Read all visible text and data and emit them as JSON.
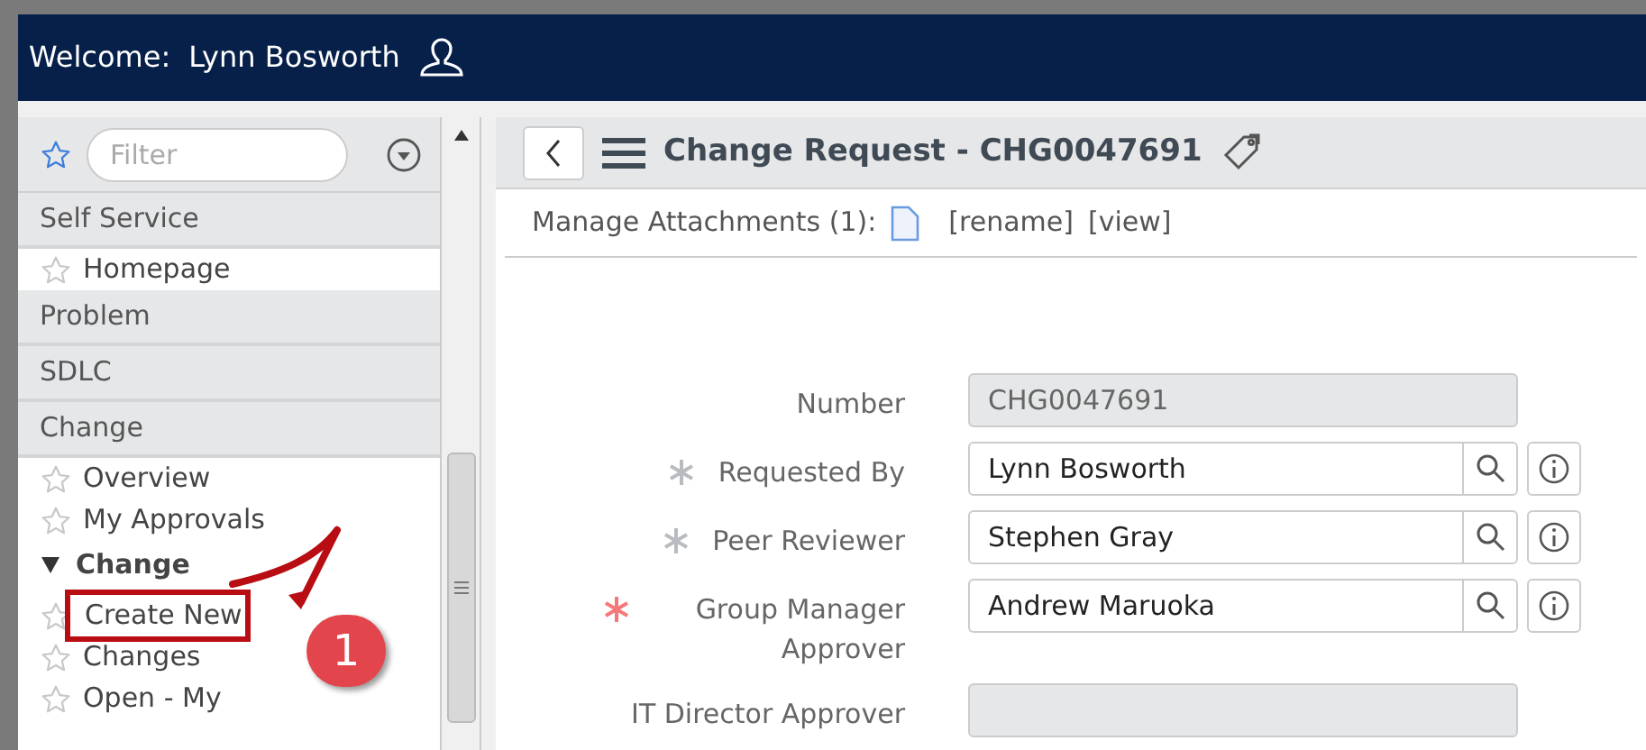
{
  "header": {
    "welcome": "Welcome:",
    "user": "Lynn Bosworth"
  },
  "sidebar": {
    "filter": {
      "placeholder": "Filter"
    },
    "items": [
      {
        "kind": "section",
        "label": "Self Service"
      },
      {
        "kind": "item",
        "label": "Homepage"
      },
      {
        "kind": "section",
        "label": "Problem"
      },
      {
        "kind": "section",
        "label": "SDLC"
      },
      {
        "kind": "section",
        "label": "Change"
      },
      {
        "kind": "item",
        "label": "Overview"
      },
      {
        "kind": "item",
        "label": "My Approvals"
      },
      {
        "kind": "group",
        "label": "Change",
        "expanded": true
      },
      {
        "kind": "item",
        "label": "Create New",
        "annotated": true
      },
      {
        "kind": "item",
        "label": "Changes",
        "annotated": false
      },
      {
        "kind": "item",
        "label": "Open - My",
        "annotated": false
      }
    ]
  },
  "annotation": {
    "step": "1"
  },
  "form": {
    "title": "Change Request - CHG0047691",
    "attachments": {
      "label": "Manage Attachments (1):",
      "rename": "[rename]",
      "view": "[view]"
    },
    "fields": [
      {
        "kind": "readonly",
        "label": "Number",
        "value": "CHG0047691",
        "required": false
      },
      {
        "kind": "reference",
        "label": "Requested By",
        "value": "Lynn Bosworth",
        "required": true,
        "color": "#b8bcc0"
      },
      {
        "kind": "reference",
        "label": "Peer Reviewer",
        "value": "Stephen Gray",
        "required": true,
        "color": "#b8bcc0"
      },
      {
        "kind": "reference",
        "label": "Group Manager Approver",
        "value": "Andrew Maruoka",
        "required": true,
        "color": "#f47a7a"
      },
      {
        "kind": "readonly",
        "label": "IT Director Approver",
        "required": false
      }
    ]
  }
}
